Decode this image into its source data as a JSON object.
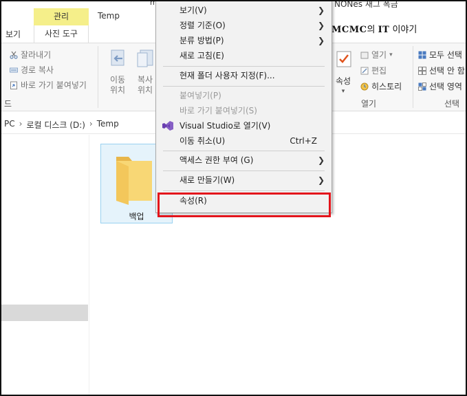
{
  "ribbon_tabs": {
    "context_tab": "관리",
    "context_subtab": "사진 도구",
    "view_tab": "보기",
    "folder_tab": "Temp",
    "cut_top_left": "m",
    "cut_top_right": "NONes 새그 폭금"
  },
  "blog": {
    "brand": "MCMC",
    "suffix_1": "의 ",
    "it": "IT",
    "suffix_2": " 이야기"
  },
  "clipboard_group": {
    "cut": "잘라내기",
    "copy_path": "경로 복사",
    "paste_shortcut": "바로 가기 붙여넣기",
    "group_label": "드"
  },
  "organize_group": {
    "move_line1": "이동",
    "move_line2": "위치",
    "copy_line1": "복사",
    "copy_line2": "위치"
  },
  "open_group": {
    "properties": "속성",
    "open": "열기",
    "edit": "편집",
    "history": "히스토리",
    "group_label": "열기"
  },
  "select_group": {
    "select_all": "모두 선택",
    "select_none": "선택 안 함",
    "invert_selection": "선택 영역",
    "group_label": "선택"
  },
  "address": {
    "pc": "PC",
    "drive": "로컬 디스크 (D:)",
    "folder": "Temp"
  },
  "files": [
    {
      "name": "백업"
    }
  ],
  "context_menu": {
    "view": "보기(V)",
    "sort_by": "정렬 기준(O)",
    "group_by": "분류 방법(P)",
    "refresh": "새로 고침(E)",
    "customize": "현재 폴더 사용자 지정(F)...",
    "paste": "붙여넣기(P)",
    "paste_shortcut": "바로 가기 붙여넣기(S)",
    "open_vs": "Visual Studio로 열기(V)",
    "undo_move": "이동 취소(U)",
    "undo_shortcut": "Ctrl+Z",
    "give_access": "액세스 권한 부여 (G)",
    "new": "새로 만들기(W)",
    "properties": "속성(R)"
  },
  "colors": {
    "highlight_box": "#e3141b",
    "context_tab_bg": "#f5ef8a",
    "folder": "#f8d775"
  }
}
